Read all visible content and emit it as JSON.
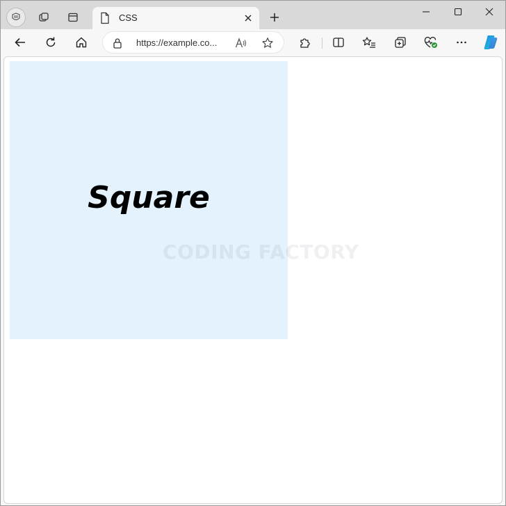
{
  "browser": {
    "tab": {
      "title": "CSS"
    },
    "address_bar": {
      "url": "https://example.co..."
    },
    "accent_color": "#2b7de9"
  },
  "page": {
    "square": {
      "label": "Square",
      "background": "#e3f2fd"
    },
    "watermark": "CODING FACTORY"
  }
}
